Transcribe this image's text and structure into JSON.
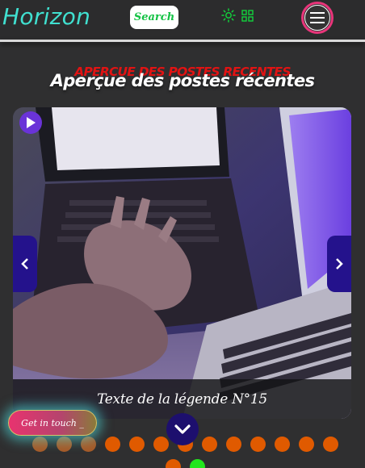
{
  "header": {
    "brand": "Horizon",
    "search_label": "Search"
  },
  "section": {
    "shadow_title": "APERCUE DES POSTES RECENTES",
    "title": "Aperçue des postes récentes"
  },
  "carousel": {
    "caption": "Texte de la légende N°15",
    "total_slides": 15,
    "active_slide": 15
  },
  "cta": {
    "label": "Get in touch _"
  },
  "colors": {
    "brand": "#40e0d0",
    "search_text": "#13c244",
    "menu_ring": "#e8357a",
    "dot": "#e05a00",
    "dot_active": "#22e61c",
    "nav_button": "#24128c"
  }
}
